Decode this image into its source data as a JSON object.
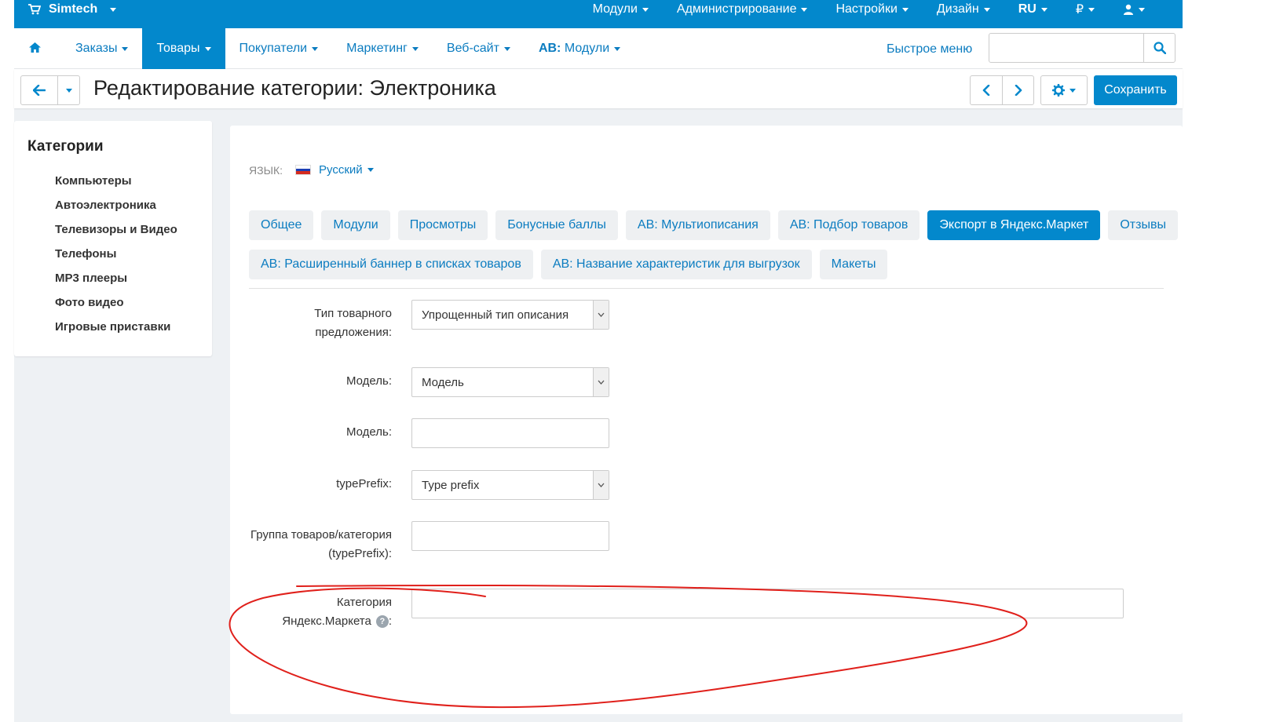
{
  "topbar": {
    "brand": "Simtech",
    "menu": [
      {
        "label": "Модули"
      },
      {
        "label": "Администрирование"
      },
      {
        "label": "Настройки"
      },
      {
        "label": "Дизайн"
      },
      {
        "label": "RU"
      },
      {
        "label": "₽"
      }
    ]
  },
  "nav": {
    "items": [
      {
        "label": "Заказы"
      },
      {
        "label": "Товары"
      },
      {
        "label": "Покупатели"
      },
      {
        "label": "Маркетинг"
      },
      {
        "label": "Веб-сайт"
      },
      {
        "prefix": "AB:",
        "label": " Модули"
      }
    ],
    "quick_menu": "Быстрое меню"
  },
  "title": {
    "text": "Редактирование категории: Электроника",
    "save": "Сохранить"
  },
  "sidebar": {
    "title": "Категории",
    "items": [
      "Компьютеры",
      "Автоэлектроника",
      "Телевизоры и Видео",
      "Телефоны",
      "MP3 плееры",
      "Фото видео",
      "Игровые приставки"
    ]
  },
  "language": {
    "label": "ЯЗЫК:",
    "value": "Русский"
  },
  "tabs": {
    "row1": [
      "Общее",
      "Модули",
      "Просмотры",
      "Бонусные баллы",
      "AB: Мультиописания",
      "AB: Подбор товаров",
      "Экспорт в Яндекс.Маркет",
      "Отзывы"
    ],
    "row2": [
      "AB: Расширенный баннер в списках товаров",
      "AB: Название характеристик для выгрузок",
      "Макеты"
    ],
    "active": "Экспорт в Яндекс.Маркет"
  },
  "form": {
    "offer_type_label_1": "Тип товарного",
    "offer_type_label_2": "предложения:",
    "offer_type_value": "Упрощенный тип описания",
    "model_select_label": "Модель:",
    "model_select_value": "Модель",
    "model_input_label": "Модель:",
    "model_input_value": "",
    "type_prefix_label": "typePrefix:",
    "type_prefix_value": "Type prefix",
    "group_label_1": "Группа товаров/категория",
    "group_label_2": "(typePrefix):",
    "group_value": "",
    "market_cat_label_1": "Категория",
    "market_cat_label_2": "Яндекс.Маркета",
    "market_cat_colon": ":",
    "market_cat_value": ""
  },
  "colors": {
    "brand": "#0388cc",
    "link": "#0b7cc0",
    "annotation": "#e0201b"
  }
}
